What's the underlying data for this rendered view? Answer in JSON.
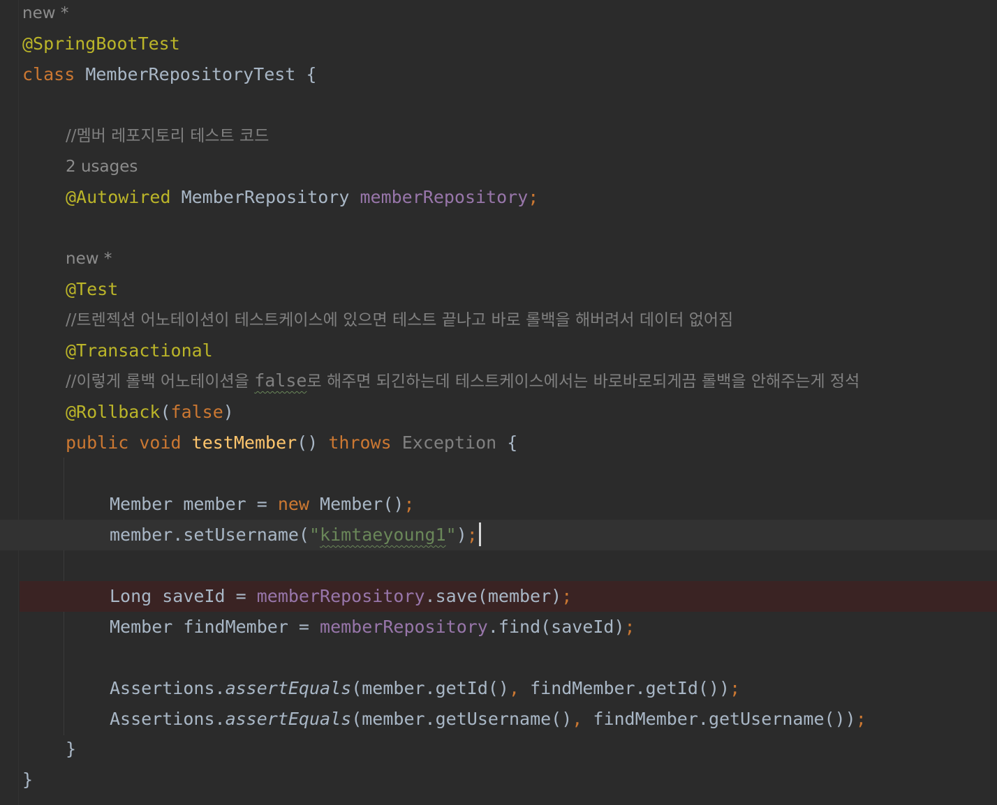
{
  "editor": {
    "class_hint": "new *",
    "class_annotation": "@SpringBootTest",
    "class_keyword": "class",
    "class_name": "MemberRepositoryTest",
    "open_brace": "{",
    "comment_member_repo": "//멤버 레포지토리 테스트 코드",
    "field_usages_hint": "2 usages",
    "field_annotation": "@Autowired",
    "field_type": "MemberRepository",
    "field_name": "memberRepository",
    "semicolon": ";",
    "method_hint": "new *",
    "test_annotation": "@Test",
    "comment_transactional": "//트렌젝션 어노테이션이 테스트케이스에 있으면 테스트 끝나고 바로 롤백을 해버려서 데이터 없어짐",
    "transactional_annotation": "@Transactional",
    "comment_rollback_prefix": "//이렇게 롤백 어노테이션을 ",
    "comment_rollback_false": "false",
    "comment_rollback_suffix": "로 해주면 되긴하는데 테스트케이스에서는 바로바로되게끔 롤백을 안해주는게 정석",
    "rollback_annotation": "@Rollback",
    "rollback_open": "(",
    "rollback_value": "false",
    "rollback_close": ")",
    "method_public": "public",
    "method_void": "void",
    "method_name": "testMember",
    "method_parens": "()",
    "method_throws": "throws",
    "method_exception": "Exception",
    "line_member_decl_a": "Member member = ",
    "line_member_decl_new": "new",
    "line_member_decl_b": " Member()",
    "line_set_a": "member.setUsername(",
    "line_set_string_q1": "\"",
    "line_set_string": "kimtaeyoung1",
    "line_set_string_q2": "\"",
    "line_set_b": ")",
    "line_save_a": "Long saveId = ",
    "line_save_field": "memberRepository",
    "line_save_b": ".save(member)",
    "line_find_a": "Member findMember = ",
    "line_find_field": "memberRepository",
    "line_find_b": ".find(saveId)",
    "line_assert1_a": "Assertions.",
    "line_assert1_fn": "assertEquals",
    "line_assert1_b": "(member.getId()",
    "line_assert1_comma": ",",
    "line_assert1_c": " findMember.getId())",
    "line_assert2_a": "Assertions.",
    "line_assert2_fn": "assertEquals",
    "line_assert2_b": "(member.getUsername()",
    "line_assert2_comma": ",",
    "line_assert2_c": " findMember.getUsername())",
    "method_close": "}",
    "class_close": "}"
  },
  "colors": {
    "background": "#2b2b2b",
    "keyword": "#cc7832",
    "annotation": "#bbb529",
    "field": "#9876aa",
    "string": "#6a8759",
    "comment": "#808080",
    "method": "#ffc66d",
    "text": "#a9b7c6",
    "breakpoint_line": "#3a2323",
    "current_line": "#323232"
  }
}
